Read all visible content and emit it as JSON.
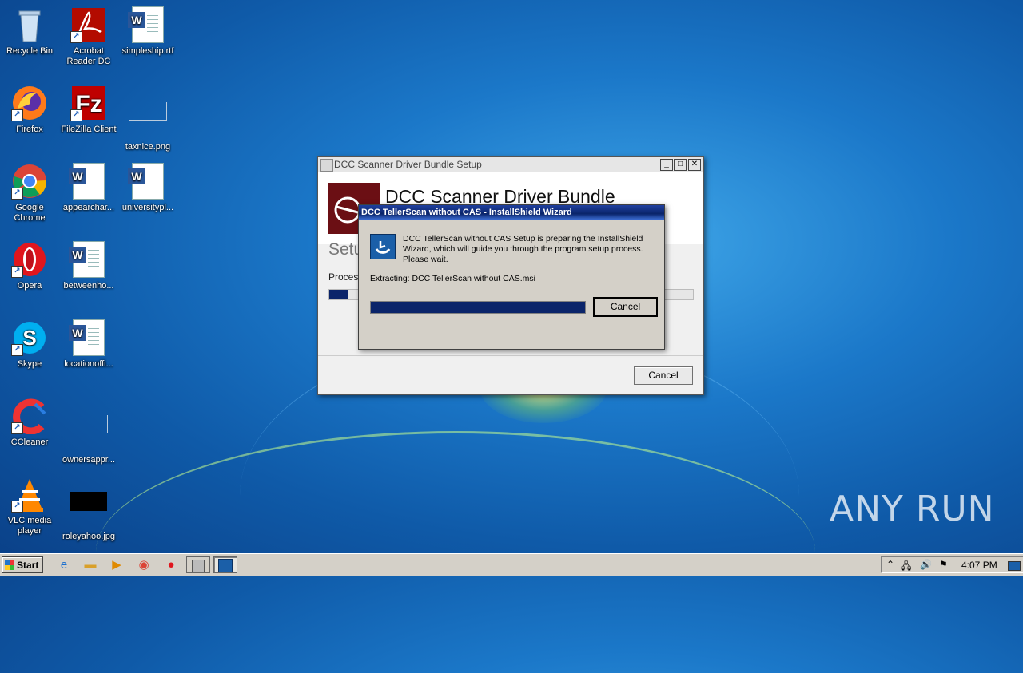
{
  "desktop": {
    "icons": [
      {
        "label": "Recycle Bin"
      },
      {
        "label": "Acrobat Reader DC"
      },
      {
        "label": "simpleship.rtf"
      },
      {
        "label": "Firefox"
      },
      {
        "label": "FileZilla Client"
      },
      {
        "label": "taxnice.png"
      },
      {
        "label": "Google Chrome"
      },
      {
        "label": "appearchar..."
      },
      {
        "label": "universitypl..."
      },
      {
        "label": "Opera"
      },
      {
        "label": "betweenho..."
      },
      {
        "label": "Skype"
      },
      {
        "label": "locationoffi..."
      },
      {
        "label": "CCleaner"
      },
      {
        "label": "ownersappr..."
      },
      {
        "label": "VLC media player"
      },
      {
        "label": "roleyahoo.jpg"
      }
    ]
  },
  "setup_window": {
    "title": "DCC Scanner Driver Bundle Setup",
    "heading": "DCC Scanner Driver Bundle",
    "subheading_partial": "Setu",
    "status_partial": "Process",
    "cancel_label": "Cancel",
    "progress_fraction": 0.05
  },
  "wizard": {
    "title": "DCC TellerScan without CAS - InstallShield Wizard",
    "message": "DCC TellerScan without CAS Setup is preparing the InstallShield Wizard, which will guide you through the program setup process. Please wait.",
    "extracting": "Extracting: DCC TellerScan without CAS.msi",
    "cancel_label": "Cancel",
    "progress_fraction": 1.0
  },
  "taskbar": {
    "start_label": "Start",
    "clock": "4:07 PM"
  },
  "watermark": "ANY RUN",
  "colors": {
    "progress_fill": "#0a246a",
    "dialog_title": "#0a246a"
  }
}
